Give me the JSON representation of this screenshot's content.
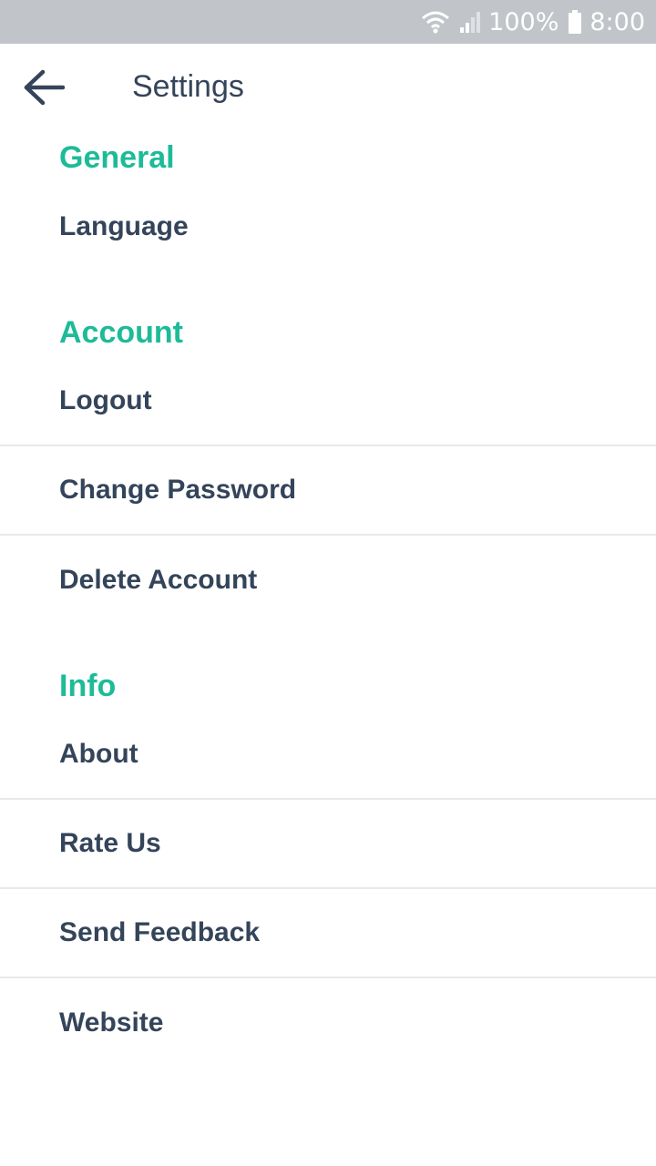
{
  "status_bar": {
    "wifi_icon": "wifi-icon",
    "signal_icon": "cell-signal-icon",
    "battery_percent": "100%",
    "battery_icon": "battery-icon",
    "time": "8:00"
  },
  "app_bar": {
    "back_icon": "arrow-back-icon",
    "title": "Settings"
  },
  "sections": [
    {
      "header": "General",
      "items": [
        "Language"
      ]
    },
    {
      "header": "Account",
      "items": [
        "Logout",
        "Change Password",
        "Delete Account"
      ]
    },
    {
      "header": "Info",
      "items": [
        "About",
        "Rate Us",
        "Send Feedback",
        "Website"
      ]
    }
  ],
  "colors": {
    "accent": "#1dbb98",
    "text": "#34445a",
    "status_bar_bg": "#c1c5c9",
    "divider": "#e8e9ea"
  }
}
